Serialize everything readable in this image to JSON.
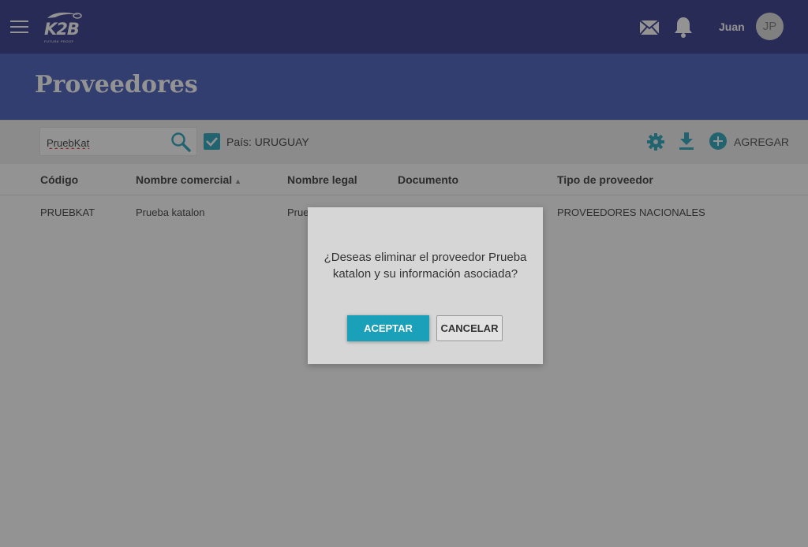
{
  "header": {
    "logo_text": "K2B",
    "logo_tagline": "FUTURE PROOF",
    "username": "Juan",
    "avatar_initials": "JP",
    "icons": {
      "menu": "hamburger-menu-icon",
      "mail": "mail-icon",
      "notifications": "bell-icon"
    }
  },
  "page": {
    "title": "Proveedores"
  },
  "filters": {
    "search_value": "PruebKat",
    "search_icon": "search-icon",
    "country_checked": true,
    "country_label": "País: URUGUAY",
    "actions": {
      "settings_icon": "gear-icon",
      "download_icon": "download-icon",
      "add_icon": "add-circle-icon",
      "add_label": "AGREGAR"
    }
  },
  "table": {
    "columns": [
      "Código",
      "Nombre comercial",
      "Nombre legal",
      "Documento",
      "Tipo de proveedor"
    ],
    "sorted_column": "Nombre comercial",
    "sort_direction": "asc",
    "rows": [
      {
        "codigo": "PRUEBKAT",
        "nombre_comercial": "Prueba katalon",
        "nombre_legal": "Prue",
        "documento": "",
        "tipo": "PROVEEDORES NACIONALES"
      }
    ]
  },
  "dialog": {
    "message": "¿Deseas eliminar el proveedor Prueba katalon y su información asociada?",
    "accept_label": "ACEPTAR",
    "cancel_label": "CANCELAR"
  },
  "colors": {
    "topbar": "#2b2f86",
    "title_band": "#3d52b8",
    "accent": "#1aa0b8",
    "dialog_bg": "#d6d6d6"
  }
}
